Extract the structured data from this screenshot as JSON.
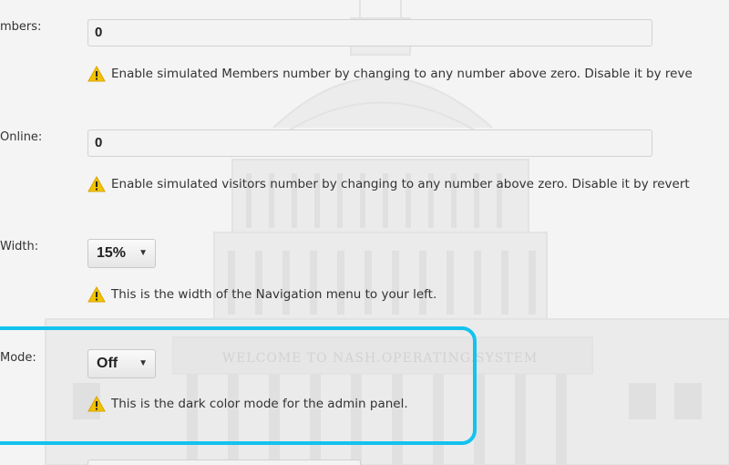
{
  "fields": [
    {
      "label": "mbers:",
      "value": "0",
      "help": "Enable simulated Members number by changing to any number above zero. Disable it by reve"
    },
    {
      "label": "Online:",
      "value": "0",
      "help": "Enable simulated visitors number by changing to any number above zero. Disable it by revert"
    },
    {
      "label": "Width:",
      "value": "15%",
      "help": "This is the width of the Navigation menu to your left."
    },
    {
      "label": "Mode:",
      "value": "Off",
      "help": "This is the dark color mode for the admin panel."
    }
  ],
  "backdrop": {
    "banner_text": "WELCOME TO NASH.OPERATING.SYSTEM",
    "icon": "capitol-building-image"
  },
  "colors": {
    "highlight": "#14c2ee",
    "warning": "#f2c200"
  },
  "icons": {
    "warning": "warning-icon",
    "dropdown": "chevron-down-icon"
  }
}
